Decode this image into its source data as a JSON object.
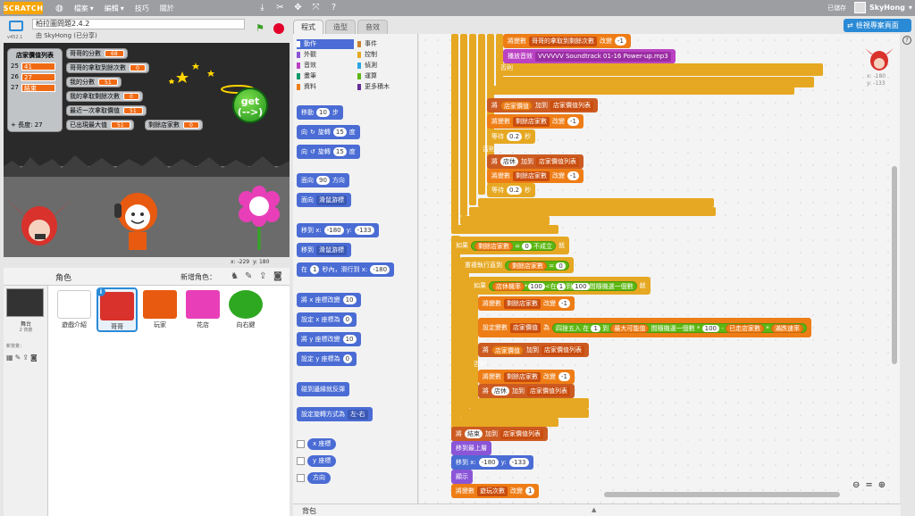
{
  "menubar": {
    "logo": "SCRATCH",
    "file": "檔案",
    "edit": "編輯",
    "tips": "技巧",
    "about": "關於",
    "saved": "已儲存",
    "username": "SkyHong"
  },
  "project": {
    "title": "柏拉圖問題2.4.2",
    "owner": "由 SkyHong (已分享)",
    "version": "v452.1"
  },
  "stage": {
    "list_title": "店家價值列表",
    "list_items": [
      {
        "idx": "25",
        "val": "41"
      },
      {
        "idx": "26",
        "val": "27"
      },
      {
        "idx": "27",
        "val": "結束"
      }
    ],
    "list_length": "長度: 27",
    "watchers": [
      {
        "label": "哥哥的分數",
        "value": "68"
      },
      {
        "label": "哥哥的拿取到餘次數",
        "value": "0"
      },
      {
        "label": "我的分數",
        "value": "51"
      },
      {
        "label": "我的拿取剩餘次數",
        "value": "0"
      },
      {
        "label": "最近一次拿取價值",
        "value": "51"
      },
      {
        "label": "已出現最大值",
        "value": "51"
      },
      {
        "label": "剩餘店家數",
        "value": "0"
      }
    ],
    "get_button": "get\n(-->)",
    "coord_x": "x: -229",
    "coord_y": "y: 180"
  },
  "sprites": {
    "title": "角色",
    "new_sprite": "新增角色：",
    "stage_label": "舞台",
    "stage_sub": "2 背景",
    "new_backdrop": "新背景：",
    "items": [
      {
        "name": "遊戲介紹",
        "color": "#ffffff"
      },
      {
        "name": "哥哥",
        "color": "#d9312b"
      },
      {
        "name": "玩家",
        "color": "#e85a10"
      },
      {
        "name": "花店",
        "color": "#e83fb8"
      },
      {
        "name": "向右鍵",
        "color": "#2fa821"
      }
    ]
  },
  "tabs": [
    "程式",
    "造型",
    "音效"
  ],
  "categories": [
    {
      "label": "動作",
      "color": "#4a6cd4"
    },
    {
      "label": "事件",
      "color": "#c88330"
    },
    {
      "label": "外觀",
      "color": "#8a55d7"
    },
    {
      "label": "控制",
      "color": "#e6a822"
    },
    {
      "label": "音效",
      "color": "#bb42c3"
    },
    {
      "label": "偵測",
      "color": "#2ca5e2"
    },
    {
      "label": "畫筆",
      "color": "#0e9a6c"
    },
    {
      "label": "運算",
      "color": "#5cb712"
    },
    {
      "label": "資料",
      "color": "#ee7d16"
    },
    {
      "label": "更多積木",
      "color": "#632d99"
    }
  ],
  "palette_blocks": {
    "move": "移動",
    "move_steps": "10",
    "steps": "步",
    "turn_r": "向",
    "turn_r_deg": "15",
    "deg": "度",
    "turn": "旋轉",
    "point_dir": "面向",
    "point_dir_val": "90",
    "direction": "方向",
    "point_towards": "面向",
    "mouse_pointer": "滑鼠游標",
    "goto_xy": "移到 x:",
    "goto_x": "-180",
    "goto_y_label": "y:",
    "goto_y": "-133",
    "goto": "移到",
    "glide": "在",
    "glide_secs": "1",
    "glide_text": "秒內，滑行到 x:",
    "glide_x": "-180",
    "change_x": "將 x 座標改變",
    "change_x_val": "10",
    "set_x": "設定 x 座標為",
    "set_x_val": "0",
    "change_y": "將 y 座標改變",
    "change_y_val": "10",
    "set_y": "設定 y 座標為",
    "set_y_val": "0",
    "bounce": "碰到邊緣就反彈",
    "rotation_style": "設定旋轉方式為",
    "rotation_val": "左-右",
    "rep_x": "x 座標",
    "rep_y": "y 座標",
    "rep_dir": "方向"
  },
  "scripts": {
    "b1_a": "將變數",
    "b1_var": "哥哥的拿取到剩餘次數",
    "b1_b": "改變",
    "b1_val": "-1",
    "b2_a": "播放音效",
    "b2_val": "VVVVVV Soundtrack 01-16 Power-up.mp3",
    "else1": "否則",
    "b3_a": "將",
    "b3_var": "店家價值",
    "b3_b": "加到",
    "b3_list": "店家價值列表",
    "b4_a": "將變數",
    "b4_var": "剩餘店家數",
    "b4_b": "改變",
    "b4_val": "-1",
    "b5_a": "等待",
    "b5_val": "0.2",
    "b5_b": "秒",
    "else2": "否則",
    "b6_a": "將",
    "b6_val": "店休",
    "b6_b": "加到",
    "b6_list": "店家價值列表",
    "b7_a": "將變數",
    "b7_var": "剩餘店家數",
    "b7_b": "改變",
    "b7_val": "-1",
    "b8_a": "等待",
    "b8_val": "0.2",
    "b8_b": "秒",
    "if1_a": "如果",
    "if1_var": "剩餘店家數",
    "if1_eq": "=",
    "if1_val": "0",
    "if1_not": "不成立",
    "if1_b": "就",
    "rep_a": "重複執行直到",
    "rep_var": "剩餘店家數",
    "rep_eq": "=",
    "rep_val": "0",
    "if2_a": "如果",
    "if2_var": "店休機率",
    "if2_op": "*",
    "if2_100": "100",
    "if2_lt": "<",
    "if2_in": "在",
    "if2_1": "1",
    "if2_to": "到",
    "if2_100b": "100",
    "if2_pick": "間隨機選一個數",
    "if2_b": "就",
    "c1_a": "將變數",
    "c1_var": "剩餘店家數",
    "c1_b": "改變",
    "c1_val": "-1",
    "c2_a": "設定變數",
    "c2_var": "店家價值",
    "c2_b": "為",
    "c2_round": "四捨五入",
    "c2_in": "在",
    "c2_1": "1",
    "c2_to": "到",
    "c2_max": "最大可能值",
    "c2_pick": "間隨機選一個數",
    "c2_star": "*",
    "c2_100": "100",
    "c2_minus": "-",
    "c2_visited": "已走店家數",
    "c2_star2": "*",
    "c2_dec": "滿跌速率",
    "c3_a": "將",
    "c3_var": "店家價值",
    "c3_b": "加到",
    "c3_list": "店家價值列表",
    "else3": "否則",
    "c4_a": "將變數",
    "c4_var": "剩餘店家數",
    "c4_b": "改變",
    "c4_val": "-1",
    "c5_a": "將",
    "c5_val": "店休",
    "c5_b": "加到",
    "c5_list": "店家價值列表",
    "d1_a": "將",
    "d1_val": "結束",
    "d1_b": "加到",
    "d1_list": "店家價值列表",
    "d2": "移到最上層",
    "d3_a": "移到 x:",
    "d3_x": "-180",
    "d3_y_label": "y:",
    "d3_y": "-133",
    "d4": "顯示",
    "d5_a": "將變數",
    "d5_var": "遊玩次數",
    "d5_b": "改變",
    "d5_val": "1"
  },
  "right": {
    "see_project": "檢視專案頁面",
    "sprite_x": "x: -180",
    "sprite_y": "y: -133"
  },
  "backpack": "背包"
}
